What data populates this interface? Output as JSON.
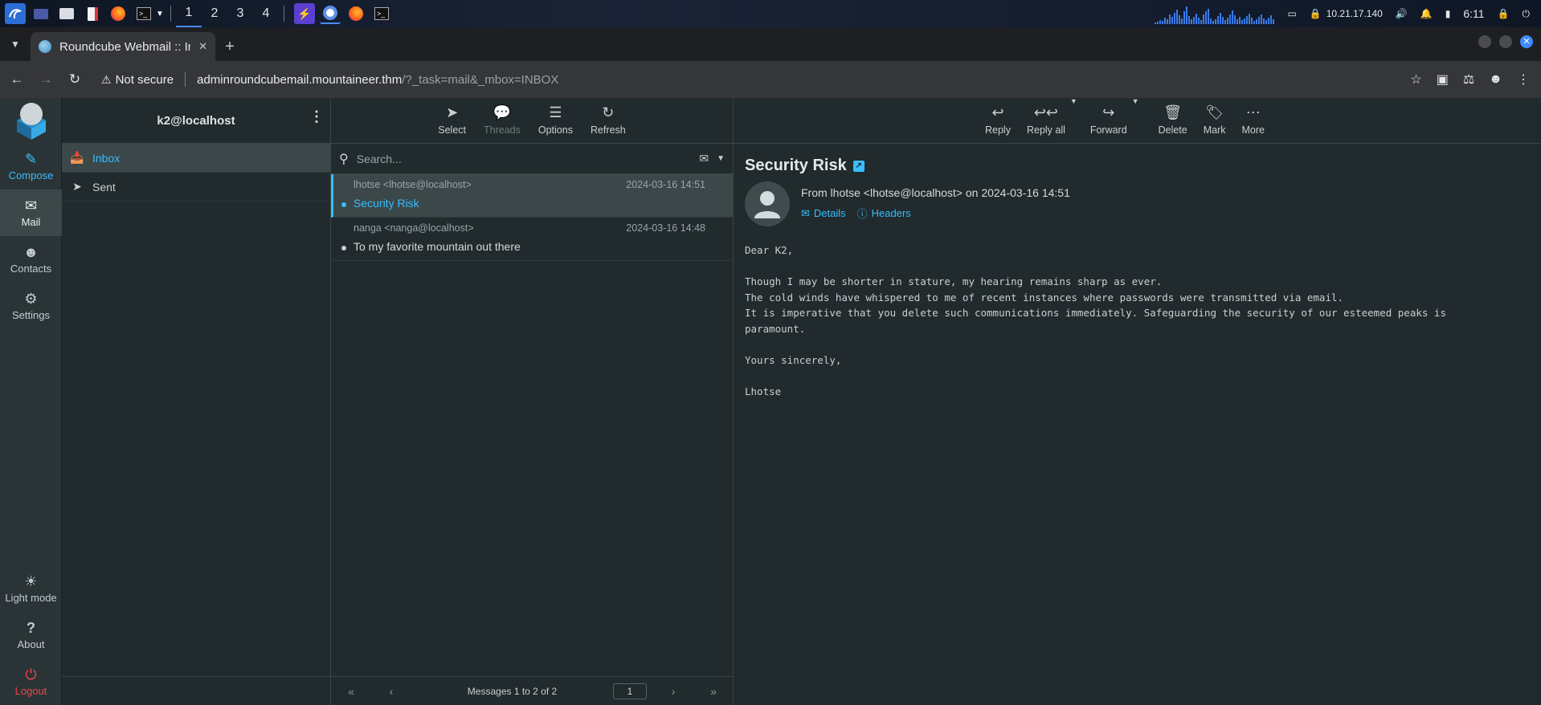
{
  "taskbar": {
    "workspaces": [
      "1",
      "2",
      "3",
      "4"
    ],
    "active_workspace": "1",
    "ip": "10.21.17.140",
    "clock": "6:11",
    "cpu_levels": [
      2,
      3,
      5,
      4,
      8,
      6,
      12,
      9,
      14,
      18,
      11,
      7,
      16,
      22,
      10,
      6,
      9,
      13,
      8,
      5,
      12,
      16,
      19,
      7,
      4,
      6,
      10,
      14,
      9,
      5,
      8,
      12,
      17,
      11,
      6,
      9,
      5,
      7,
      10,
      13,
      8,
      4,
      6,
      9,
      12,
      7,
      5,
      8,
      11,
      6
    ]
  },
  "browser": {
    "tab_title": "Roundcube Webmail :: In",
    "security_label": "Not secure",
    "url_host": "adminroundcubemail.mountaineer.thm",
    "url_path": "/?_task=mail&_mbox=INBOX"
  },
  "nav": {
    "compose": "Compose",
    "mail": "Mail",
    "contacts": "Contacts",
    "settings": "Settings",
    "light_mode": "Light mode",
    "about": "About",
    "logout": "Logout"
  },
  "folders": {
    "account": "k2@localhost",
    "items": [
      {
        "label": "Inbox",
        "icon": "inbox-icon"
      },
      {
        "label": "Sent",
        "icon": "send-icon"
      }
    ]
  },
  "list": {
    "toolbar": {
      "select": "Select",
      "threads": "Threads",
      "options": "Options",
      "refresh": "Refresh"
    },
    "search_placeholder": "Search...",
    "messages": [
      {
        "from": "lhotse <lhotse@localhost>",
        "date": "2024-03-16 14:51",
        "subject": "Security Risk"
      },
      {
        "from": "nanga <nanga@localhost>",
        "date": "2024-03-16 14:48",
        "subject": "To my favorite mountain out there"
      }
    ],
    "count_text": "Messages 1 to 2 of 2",
    "page": "1"
  },
  "reader": {
    "toolbar": {
      "reply": "Reply",
      "reply_all": "Reply all",
      "forward": "Forward",
      "delete": "Delete",
      "mark": "Mark",
      "more": "More"
    },
    "subject": "Security Risk",
    "from_line": "From lhotse <lhotse@localhost> on 2024-03-16 14:51",
    "details_link": "Details",
    "headers_link": "Headers",
    "body": "Dear K2,\n\nThough I may be shorter in stature, my hearing remains sharp as ever.\nThe cold winds have whispered to me of recent instances where passwords were transmitted via email.\nIt is imperative that you delete such communications immediately. Safeguarding the security of our esteemed peaks is\nparamount.\n\nYours sincerely,\n\nLhotse"
  },
  "colors": {
    "accent": "#37beff",
    "logout": "#ef4646",
    "panel_bg": "#212a2c",
    "selected_bg": "#3b4749"
  }
}
